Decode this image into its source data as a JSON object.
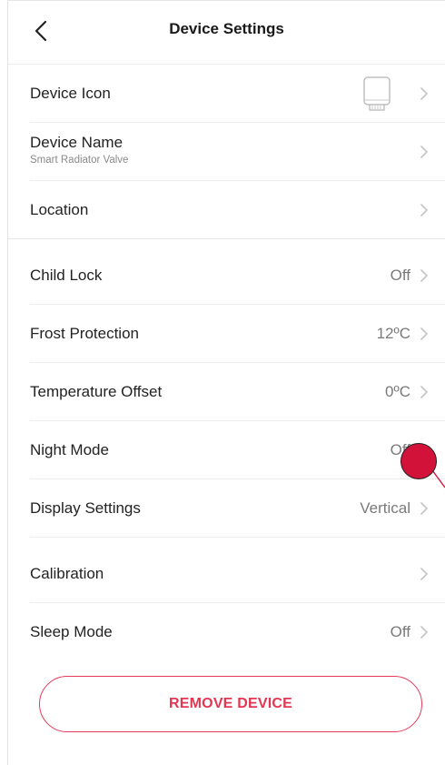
{
  "header": {
    "title": "Device Settings",
    "back_icon": "chevron-left-icon"
  },
  "rows": [
    {
      "id": "device-icon",
      "label": "Device Icon",
      "value": "",
      "icon": "radiator-valve-icon"
    },
    {
      "id": "device-name",
      "label": "Device Name",
      "sublabel": "Smart Radiator Valve",
      "value": ""
    },
    {
      "id": "location",
      "label": "Location",
      "value": ""
    },
    {
      "id": "child-lock",
      "label": "Child Lock",
      "value": "Off"
    },
    {
      "id": "frost-protection",
      "label": "Frost Protection",
      "value": "12ºC"
    },
    {
      "id": "temperature-offset",
      "label": "Temperature Offset",
      "value": "0ºC"
    },
    {
      "id": "night-mode",
      "label": "Night Mode",
      "value": "Off"
    },
    {
      "id": "display-settings",
      "label": "Display Settings",
      "value": "Vertical"
    },
    {
      "id": "calibration",
      "label": "Calibration",
      "value": ""
    },
    {
      "id": "sleep-mode",
      "label": "Sleep Mode",
      "value": "Off"
    }
  ],
  "actions": {
    "remove_label": "REMOVE DEVICE"
  },
  "colors": {
    "accent": "#e23652",
    "touch_indicator": "#d3123a",
    "divider": "#ececec",
    "value_text": "#7a7a7a"
  }
}
